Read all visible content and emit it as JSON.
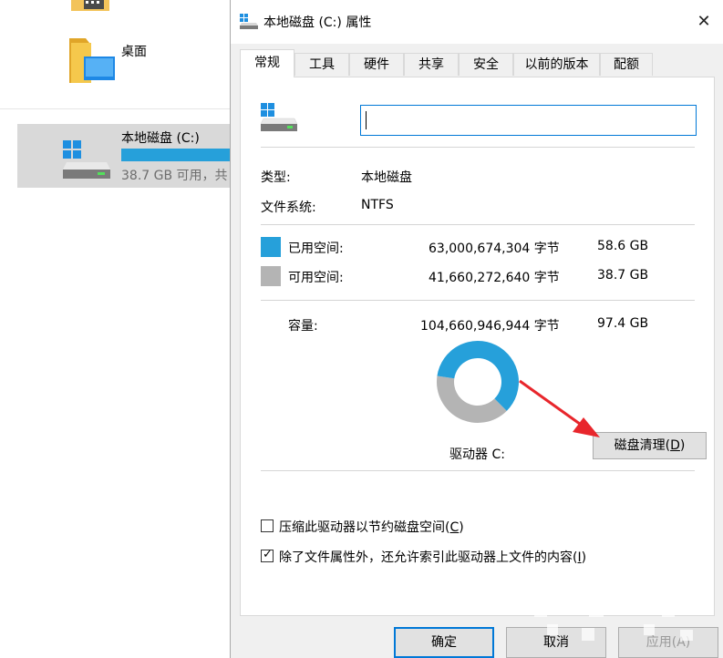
{
  "explorer": {
    "desktop_label": "桌面",
    "drive_name": "本地磁盘 (C:)",
    "drive_free": "38.7 GB 可用，共",
    "drive_used_fraction": 0.602
  },
  "dialog": {
    "title": "本地磁盘 (C:) 属性",
    "close_glyph": "✕",
    "tabs": [
      "常规",
      "工具",
      "硬件",
      "共享",
      "安全",
      "以前的版本",
      "配额"
    ],
    "active_tab": "常规",
    "name_input_value": "",
    "type_label": "类型:",
    "type_value": "本地磁盘",
    "fs_label": "文件系统:",
    "fs_value": "NTFS",
    "used_label": "已用空间:",
    "used_bytes": "63,000,674,304 字节",
    "used_gb": "58.6 GB",
    "free_label": "可用空间:",
    "free_bytes": "41,660,272,640 字节",
    "free_gb": "38.7 GB",
    "capacity_label": "容量:",
    "capacity_bytes": "104,660,946,944 字节",
    "capacity_gb": "97.4 GB",
    "drive_label": "驱动器 C:",
    "cleanup_button_pre": "磁盘清理(",
    "cleanup_button_key": "D",
    "cleanup_button_post": ")",
    "compress_pre": "压缩此驱动器以节约磁盘空间(",
    "compress_key": "C",
    "compress_post": ")",
    "compress_checked": false,
    "index_pre": "除了文件属性外，还允许索引此驱动器上文件的内容(",
    "index_key": "I",
    "index_post": ")",
    "index_checked": true,
    "ok_label": "确定",
    "cancel_label": "取消",
    "apply_label": "应用(A)",
    "used_fraction": 0.602
  },
  "colors": {
    "used": "#26a0da",
    "free": "#b4b4b4",
    "accent": "#0078d7",
    "arrow": "#e8262c"
  }
}
